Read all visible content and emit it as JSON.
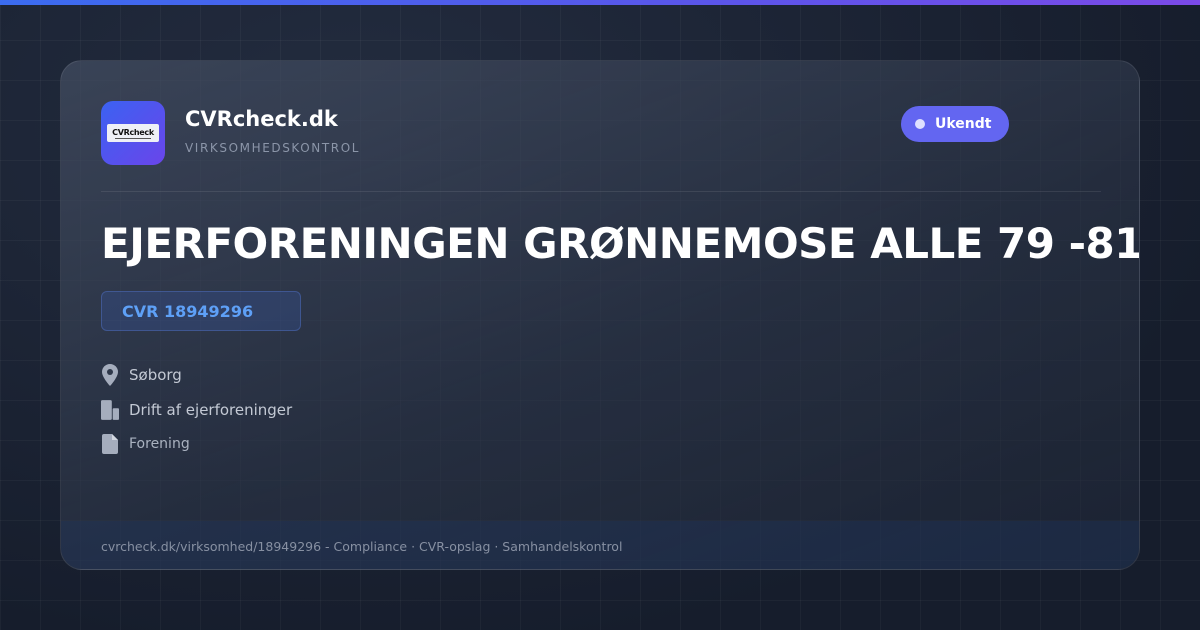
{
  "brand": {
    "logo_text": "CVRcheck",
    "name": "CVRcheck.dk",
    "tagline": "VIRKSOMHEDSKONTROL"
  },
  "status": {
    "label": "Ukendt",
    "color": "#6366f1"
  },
  "company": {
    "name": "EJERFORENINGEN GRØNNEMOSE ALLE 79 -81",
    "cvr": "CVR 18949296"
  },
  "details": {
    "location": "Søborg",
    "industry": "Drift af ejerforeninger",
    "company_type": "Forening"
  },
  "icons": {
    "location": "map-pin-icon",
    "industry": "building-icon",
    "company_type": "document-icon"
  },
  "footer": {
    "text": "cvrcheck.dk/virksomhed/18949296 - Compliance · CVR-opslag · Samhandelskontrol"
  },
  "colors": {
    "accent_gradient_start": "#3b6cf0",
    "accent_gradient_end": "#7b4ae8",
    "cvr_text": "#5ea0f7",
    "background": "#1a2234"
  }
}
